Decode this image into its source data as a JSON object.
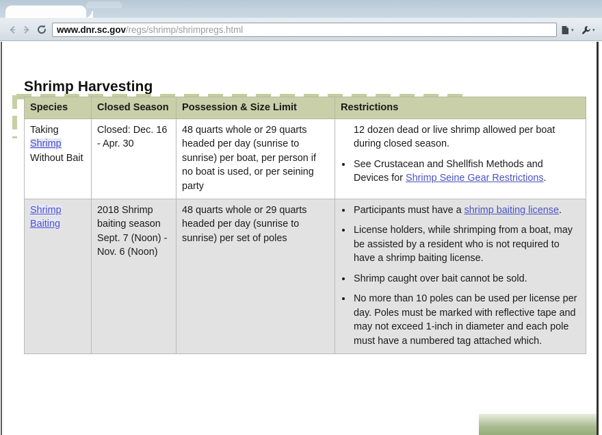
{
  "browser": {
    "tab_title": "",
    "back_icon": "back-arrow-icon",
    "forward_icon": "forward-arrow-icon",
    "reload_icon": "reload-icon",
    "url_domain": "www.dnr.sc.gov",
    "url_path": "/regs/shrimp/shrimpregs.html",
    "url_full": "www.dnr.sc.gov/regs/shrimp/shrimpregs.html",
    "page_menu_icon": "page-menu-icon",
    "wrench_menu_icon": "wrench-menu-icon",
    "caret": "▾"
  },
  "page": {
    "title": "Shrimp Harvesting"
  },
  "colors": {
    "header_bg": "#c9cfa8",
    "row_alt_bg": "#e2e2e2",
    "link": "#4a53c4",
    "selection_green": "#b5c189",
    "table_border": "#b9b9b9"
  },
  "table": {
    "columns": [
      "Species",
      "Closed Season",
      "Possession & Size Limit",
      "Restrictions"
    ],
    "rows": [
      {
        "species_pre": "Taking ",
        "species_link": "Shrimp",
        "species_post": " Without Bait",
        "closed_season": "Closed: Dec. 16 - Apr. 30",
        "possession": "48 quarts whole or 29 quarts headed per day (sunrise to sunrise) per boat, per person if no boat is used, or per seining party",
        "restrictions": [
          {
            "text": "12 dozen dead or live shrimp allowed per boat during closed season.",
            "marker": false
          },
          {
            "text_pre": "See Crustacean and Shellfish Methods and Devices for ",
            "link": "Shrimp Seine Gear Restrictions",
            "text_post": ".",
            "marker": true
          }
        ]
      },
      {
        "species_link": "Shrimp Baiting",
        "closed_season": "2018 Shrimp baiting season Sept. 7 (Noon) - Nov. 6 (Noon)",
        "possession": "48 quarts whole or 29 quarts headed per day (sunrise to sunrise) per set of poles",
        "restrictions": [
          {
            "text_pre": "Participants must have a ",
            "link": "shrimp baiting license",
            "text_post": ".",
            "marker": true
          },
          {
            "text": "License holders, while shrimping from a boat, may be assisted by a resident who is not required to have a shrimp baiting license.",
            "marker": true
          },
          {
            "text": "Shrimp caught over bait cannot be sold.",
            "marker": true
          },
          {
            "text": "No more than 10 poles can be used per license per day. Poles must be marked with reflective tape and may not exceed 1-inch in diameter and each pole must have a numbered tag attached which.",
            "marker": true
          }
        ]
      }
    ]
  }
}
